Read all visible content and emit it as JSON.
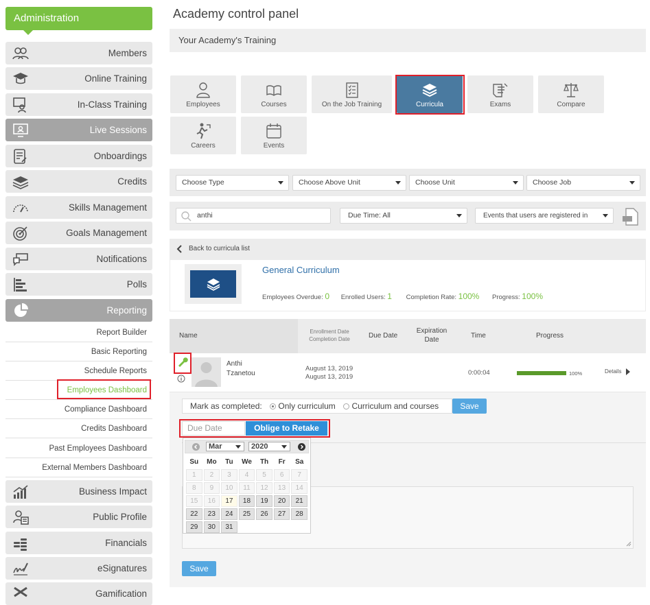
{
  "sidebar": {
    "header": "Administration",
    "items": [
      {
        "label": "Members",
        "icon": "members-icon"
      },
      {
        "label": "Online Training",
        "icon": "graduation-cap-icon"
      },
      {
        "label": "In-Class Training",
        "icon": "classroom-icon"
      },
      {
        "label": "Live Sessions",
        "icon": "video-conference-icon",
        "active": true
      },
      {
        "label": "Onboardings",
        "icon": "checklist-icon"
      },
      {
        "label": "Credits",
        "icon": "layers-icon"
      },
      {
        "label": "Skills Management",
        "icon": "gauge-icon"
      },
      {
        "label": "Goals Management",
        "icon": "target-icon"
      },
      {
        "label": "Notifications",
        "icon": "chat-bubbles-icon"
      },
      {
        "label": "Polls",
        "icon": "bar-chart-icon"
      },
      {
        "label": "Reporting",
        "icon": "pie-chart-icon",
        "active": true
      }
    ],
    "reporting_sub": [
      "Report Builder",
      "Basic Reporting",
      "Schedule Reports",
      "Employees Dashboard",
      "Compliance Dashboard",
      "Credits Dashboard",
      "Past Employees Dashboard",
      "External Members Dashboard"
    ],
    "items_after": [
      {
        "label": "Business Impact",
        "icon": "trend-chart-icon"
      },
      {
        "label": "Public Profile",
        "icon": "profile-card-icon"
      },
      {
        "label": "Financials",
        "icon": "coins-icon"
      },
      {
        "label": "eSignatures",
        "icon": "signature-icon"
      },
      {
        "label": "Gamification",
        "icon": "gamification-icon"
      }
    ]
  },
  "main": {
    "title": "Academy control panel",
    "section": "Your Academy's Training",
    "tiles": [
      {
        "label": "Employees",
        "icon": "person-icon"
      },
      {
        "label": "Courses",
        "icon": "open-book-icon"
      },
      {
        "label": "On the Job Training",
        "icon": "clipboard-checklist-icon"
      },
      {
        "label": "Curricula",
        "icon": "book-stack-icon",
        "selected": true
      },
      {
        "label": "Exams",
        "icon": "exam-icon"
      },
      {
        "label": "Compare",
        "icon": "scales-icon"
      },
      {
        "label": "Careers",
        "icon": "career-runner-icon"
      },
      {
        "label": "Events",
        "icon": "calendar-icon"
      }
    ],
    "filters": [
      "Choose Type",
      "Choose Above Unit",
      "Choose Unit",
      "Choose Job"
    ],
    "search_value": "anthi",
    "due_time": "Due Time: All",
    "events_filter": "Events that users are registered in",
    "back_link": "Back to curricula list",
    "curriculum": {
      "name": "General Curriculum",
      "overdue_label": "Employees Overdue:",
      "overdue": "0",
      "enrolled_label": "Enrolled Users:",
      "enrolled": "1",
      "completion_label": "Completion Rate:",
      "completion": "100%",
      "progress_label": "Progress:",
      "progress": "100%"
    },
    "table": {
      "headers": {
        "name": "Name",
        "enroll1": "Enrollment Date",
        "enroll2": "Completion Date",
        "due": "Due Date",
        "exp1": "Expiration",
        "exp2": "Date",
        "time": "Time",
        "progress": "Progress"
      },
      "row": {
        "first": "Anthi",
        "last": "Tzanetou",
        "enroll": "August 13, 2019",
        "complete": "August 13, 2019",
        "time": "0:00:04",
        "progress_pct": "100%",
        "progress_value": 1.0,
        "details": "Details"
      }
    },
    "mark_label": "Mark as completed:",
    "opt_only": "Only curriculum",
    "opt_both": "Curriculum and courses",
    "save": "Save",
    "due_placeholder": "Due Date",
    "oblige": "Oblige to Retake",
    "calendar": {
      "month": "Mar",
      "year": "2020",
      "days": [
        "Su",
        "Mo",
        "Tu",
        "We",
        "Th",
        "Fr",
        "Sa"
      ],
      "weeks": [
        [
          "1",
          "2",
          "3",
          "4",
          "5",
          "6",
          "7"
        ],
        [
          "8",
          "9",
          "10",
          "11",
          "12",
          "13",
          "14"
        ],
        [
          "15",
          "16",
          "17",
          "18",
          "19",
          "20",
          "21"
        ],
        [
          "22",
          "23",
          "24",
          "25",
          "26",
          "27",
          "28"
        ],
        [
          "29",
          "30",
          "31",
          "",
          "",
          "",
          ""
        ]
      ]
    },
    "save_bottom": "Save"
  }
}
